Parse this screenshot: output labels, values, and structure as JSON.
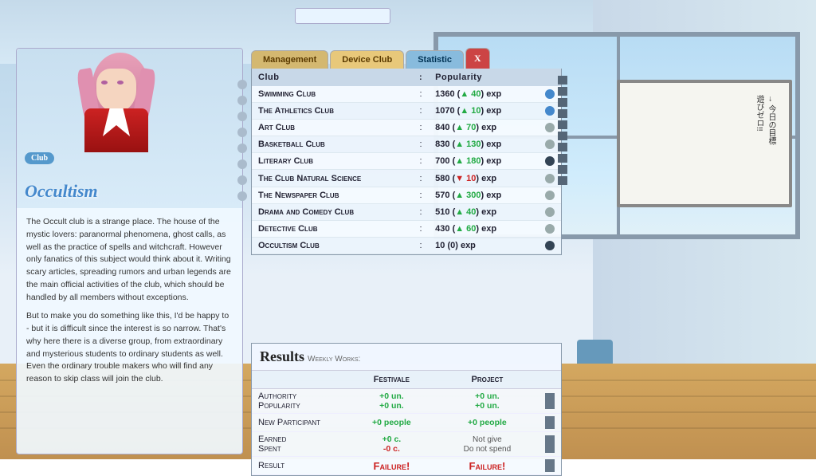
{
  "tabs": [
    {
      "label": "Management",
      "class": "tab-management"
    },
    {
      "label": "Device Club",
      "class": "tab-device"
    },
    {
      "label": "Statistic",
      "class": "tab-statistic"
    },
    {
      "label": "X",
      "class": "tab-close"
    }
  ],
  "table": {
    "headers": [
      "Club",
      ":",
      "Popularity"
    ],
    "rows": [
      {
        "name": "Swimming Club",
        "pop": "1360",
        "gain": "+40",
        "gainClass": "pop-gain-green",
        "dot": "dot-blue"
      },
      {
        "name": "The Athletics Club",
        "pop": "1070",
        "gain": "+10",
        "gainClass": "pop-gain-green",
        "dot": "dot-blue"
      },
      {
        "name": "Art Club",
        "pop": "840",
        "gain": "+70",
        "gainClass": "pop-gain-green",
        "dot": "dot-gray"
      },
      {
        "name": "Basketball Club",
        "pop": "830",
        "gain": "+130",
        "gainClass": "pop-gain-green",
        "dot": "dot-gray"
      },
      {
        "name": "Literary Club",
        "pop": "700",
        "gain": "+180",
        "gainClass": "pop-gain-green",
        "dot": "dot-dark"
      },
      {
        "name": "The Club Natural Science",
        "pop": "580",
        "gain": "-10",
        "gainClass": "pop-gain-red",
        "dot": "dot-gray"
      },
      {
        "name": "The Newspaper Club",
        "pop": "570",
        "gain": "+300",
        "gainClass": "pop-gain-green",
        "dot": "dot-gray"
      },
      {
        "name": "Drama and Comedy Club",
        "pop": "510",
        "gain": "+40",
        "gainClass": "pop-gain-green",
        "dot": "dot-gray"
      },
      {
        "name": "Detective Club",
        "pop": "430",
        "gain": "+60",
        "gainClass": "pop-gain-green",
        "dot": "dot-gray"
      },
      {
        "name": "Occultism Club",
        "pop": "10",
        "gain": "0",
        "gainClass": "",
        "dot": "dot-dark"
      }
    ]
  },
  "results": {
    "title": "Results",
    "subtitle": "Weekly Works:",
    "col_festivale": "Festivale",
    "col_project": "Project",
    "rows": [
      {
        "label": "Authority\nPopularity",
        "festivale_line1": "+0 un.",
        "festivale_line2": "+0 un.",
        "project_line1": "+0 un.",
        "project_line2": "+0 un."
      },
      {
        "label": "New Participant",
        "festivale_val": "+0 people",
        "project_val": "+0 people"
      },
      {
        "label": "Earned\nSpent",
        "festivale_line1": "+0 c.",
        "festivale_line2": "-0 c.",
        "project_line1": "Not give",
        "project_line2": "Do not spend"
      },
      {
        "label": "Result",
        "festivale_val": "Failure!",
        "project_val": "Failure!"
      }
    ]
  },
  "character": {
    "club_badge": "Club",
    "name": "Occultism",
    "description1": "The Occult club is a strange place. The house of the mystic lovers: paranormal phenomena, ghost calls, as well as the practice of spells and witchcraft. However only fanatics of this subject would think about it. Writing scary articles, spreading rumors and urban legends are the main official activities of the club, which should be handled by all members without exceptions.",
    "description2": "But to make you do something like this, I'd be happy to - but it is difficult since the interest is so narrow. That's why here there is a diverse group, from extraordinary and mysterious students to ordinary students as well. Even the ordinary trouble makers who will find any reason to skip class will join the club."
  }
}
